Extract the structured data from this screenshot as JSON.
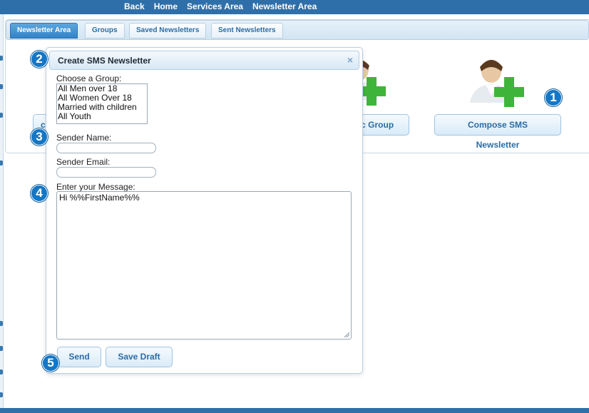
{
  "topnav": {
    "back": "Back",
    "home": "Home",
    "services": "Services Area",
    "newsletter": "Newsletter Area"
  },
  "tabs": [
    {
      "label": "Newsletter Area",
      "active": true
    },
    {
      "label": "Groups"
    },
    {
      "label": "Saved Newsletters"
    },
    {
      "label": "Sent Newsletters"
    }
  ],
  "panel": {
    "left_button_partial": "c",
    "public_group_partial": "ic Group",
    "compose_sms": "Compose SMS Newsletter"
  },
  "dialog": {
    "title": "Create SMS Newsletter",
    "close_glyph": "×",
    "choose_group_label": "Choose a Group:",
    "groups": [
      "All Men over 18",
      "All Women Over 18",
      "Married with children",
      "All Youth"
    ],
    "sender_name_label": "Sender Name:",
    "sender_name_value": "",
    "sender_email_label": "Sender Email:",
    "sender_email_value": "",
    "message_label": "Enter your Message:",
    "message_value": "Hi %%FirstName%%",
    "send_label": "Send",
    "save_draft_label": "Save Draft"
  },
  "callouts": [
    "1",
    "2",
    "3",
    "4",
    "5"
  ],
  "icons": {
    "person_add": "person-add-icon",
    "close": "close-icon"
  },
  "colors": {
    "brand": "#2f6fa9",
    "tab_active": "#3482c6",
    "button_text": "#2b6ca3",
    "callout": "#1477c6",
    "plus_green": "#3fb43a"
  }
}
